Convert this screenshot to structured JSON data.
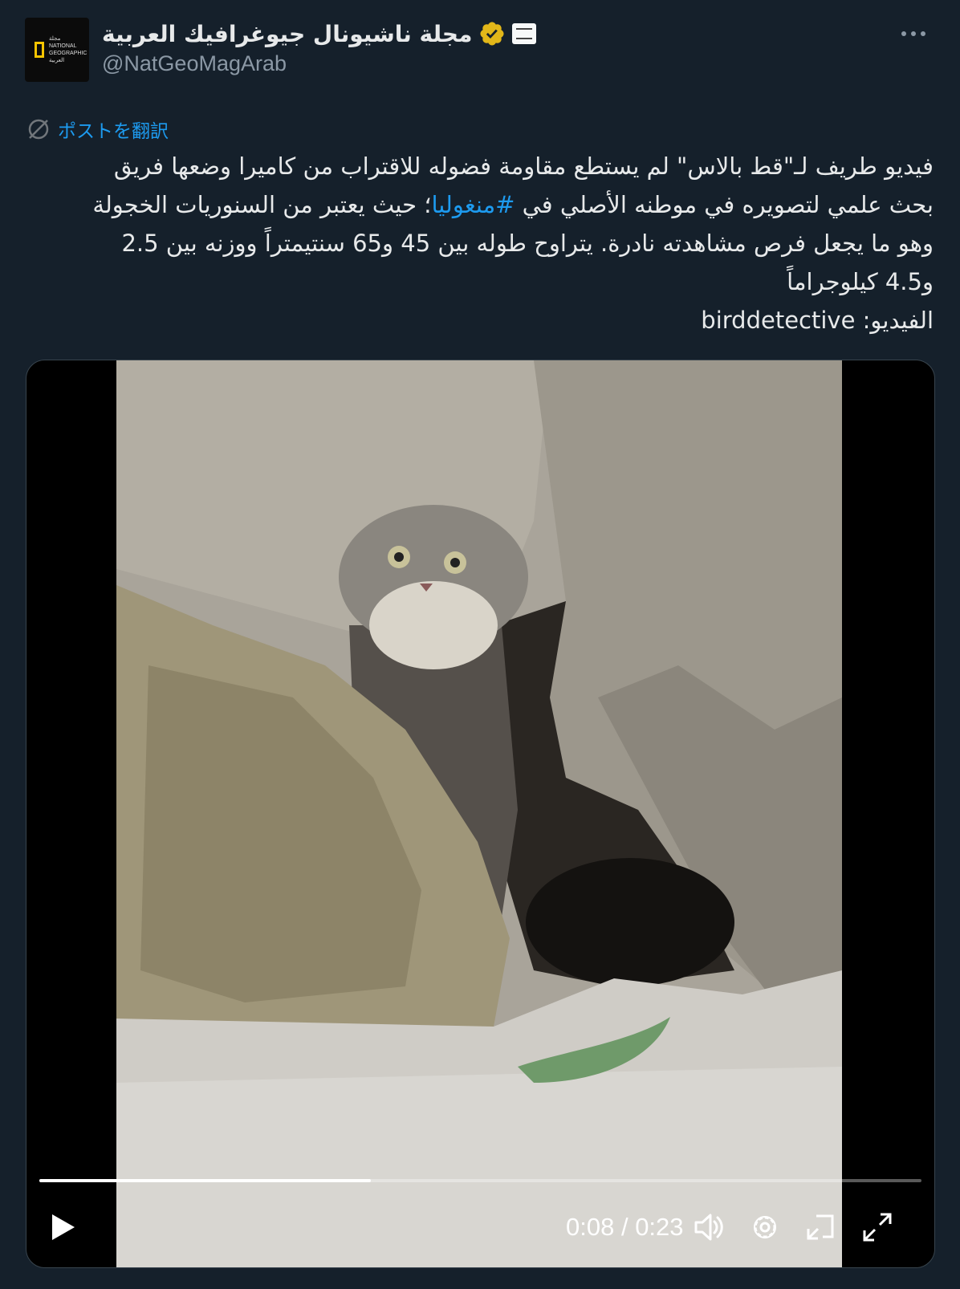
{
  "header": {
    "avatar_text": "مجلة NATIONAL GEOGRAPHIC العربية",
    "display_name": "مجلة ناشيونال جيوغرافيك العربية",
    "handle": "@NatGeoMagArab",
    "verified_icon": "verified-gold-badge-icon",
    "affiliate_icon": "affiliate-badge-icon",
    "more_icon": "more-options-icon"
  },
  "translate": {
    "label": "ポストを翻訳",
    "icon": "translate-icon"
  },
  "post": {
    "line1": "فيديو طريف لـ\"قط بالاس\" لم يستطع مقاومة فضوله للاقتراب من كاميرا وضعها فريق",
    "line2_pre": "بحث علمي لتصويره في موطنه الأصلي في ",
    "hashtag": "#منغوليا",
    "line2_post": "؛ حيث يعتبر من السنوريات الخجولة",
    "line3": "وهو ما يجعل فرص مشاهدته نادرة. يتراوح طوله بين 45 و65 سنتيمتراً ووزنه بين 2.5",
    "line4": "و4.5 كيلوجراماً",
    "line5": "الفيديو: birddetective",
    "link_color": "#1d9bf0"
  },
  "video": {
    "current_time": "0:08",
    "separator": " / ",
    "duration": "0:23",
    "progress_fraction": 0.376,
    "controls": [
      "play-icon",
      "volume-icon",
      "settings-icon",
      "pip-icon",
      "fullscreen-icon"
    ]
  }
}
